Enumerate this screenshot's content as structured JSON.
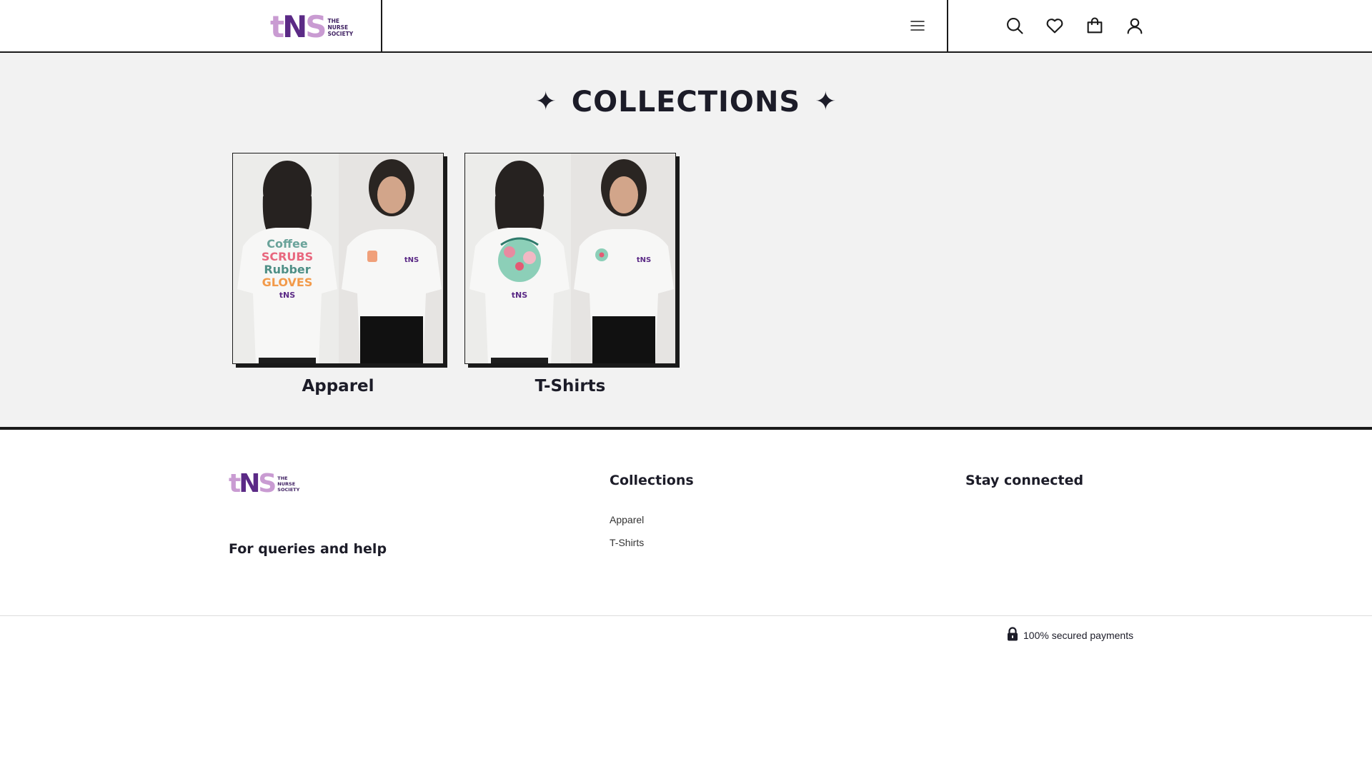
{
  "header": {
    "logo": {
      "mark_t": "t",
      "mark_n": "N",
      "mark_s": "S",
      "line1": "THE",
      "line2": "NURSE",
      "line3": "SOCIETY"
    },
    "icons": [
      "menu-icon",
      "search-icon",
      "heart-icon",
      "bag-icon",
      "user-icon"
    ]
  },
  "main": {
    "title": "COLLECTIONS",
    "star": "✦",
    "collections": [
      {
        "label": "Apparel",
        "front_print": "coffee-scrubs-rubber-gloves"
      },
      {
        "label": "T-Shirts",
        "front_print": "floral-globe"
      }
    ],
    "background": "#f2f2f2"
  },
  "footer": {
    "logo": {
      "mark_t": "t",
      "mark_n": "N",
      "mark_s": "S",
      "line1": "THE",
      "line2": "NURSE",
      "line3": "SOCIETY"
    },
    "queries_heading": "For queries and help",
    "collections_heading": "Collections",
    "collection_links": [
      "Apparel",
      "T-Shirts"
    ],
    "stay_connected_heading": "Stay connected",
    "secure_text": "100% secured payments",
    "secure_icon": "lock-icon"
  },
  "colors": {
    "brand_light": "#c99bd2",
    "brand_dark": "#5b2a86",
    "text": "#1c1c28"
  }
}
